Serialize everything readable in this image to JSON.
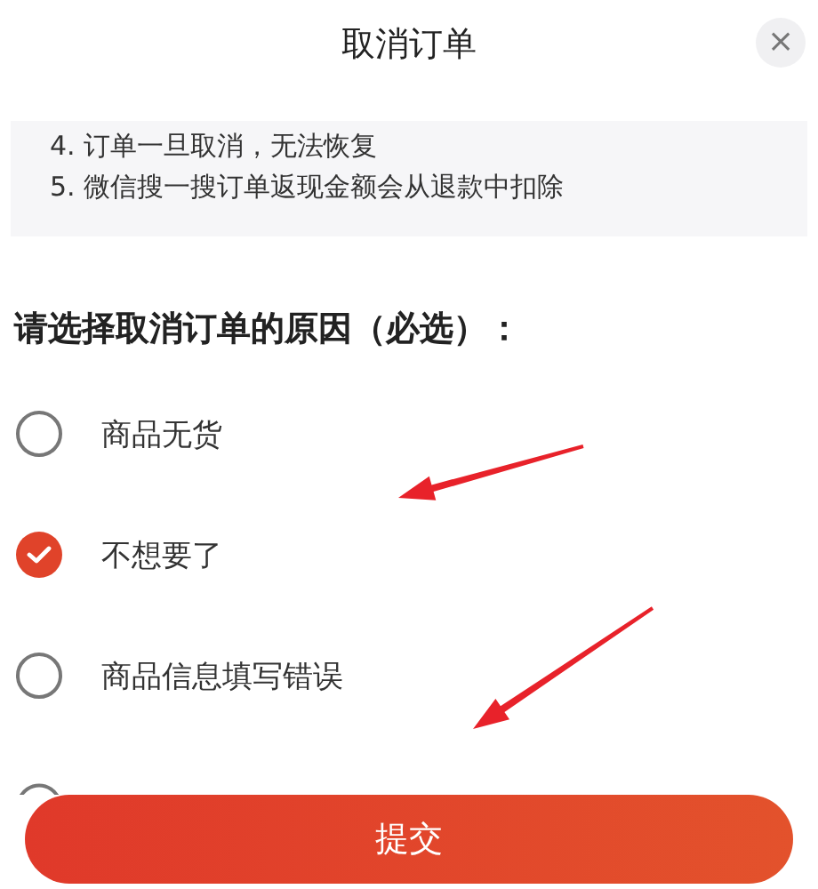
{
  "title": "取消订单",
  "close": {
    "label": "×"
  },
  "notice": [
    "4. 订单一旦取消，无法恢复",
    "5. 微信搜一搜订单返现金额会从退款中扣除"
  ],
  "prompt": "请选择取消订单的原因（必选）：",
  "reasons": [
    {
      "label": "商品无货",
      "selected": false
    },
    {
      "label": "不想要了",
      "selected": true
    },
    {
      "label": "商品信息填写错误",
      "selected": false
    }
  ],
  "submit": "提交",
  "annotations": [
    {
      "kind": "arrow"
    },
    {
      "kind": "arrow"
    }
  ]
}
